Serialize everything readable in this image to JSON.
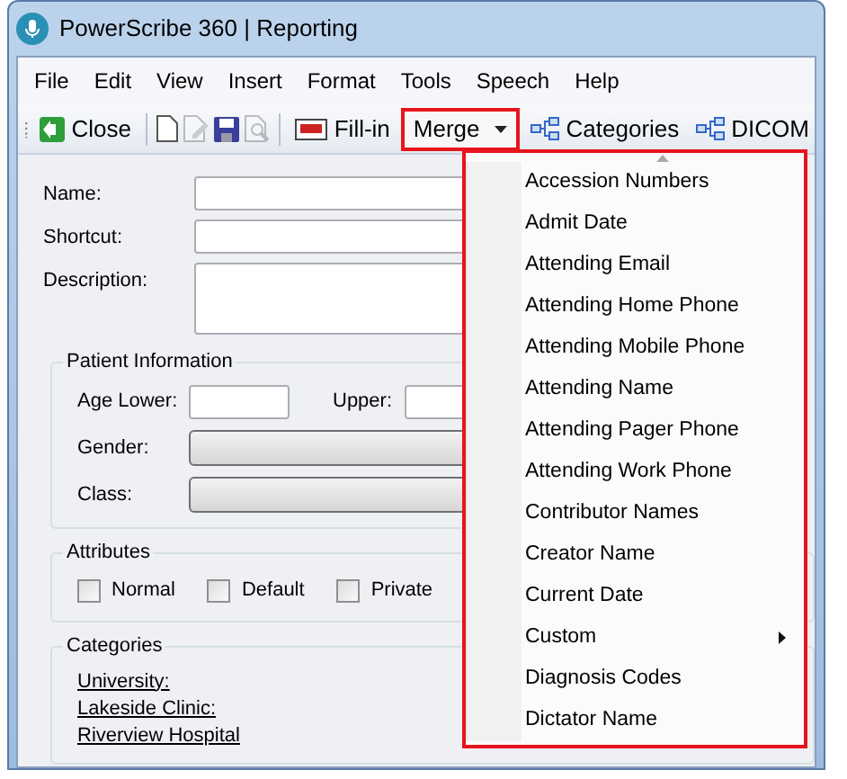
{
  "window": {
    "title": "PowerScribe 360 | Reporting"
  },
  "menu_bar": [
    {
      "label": "File"
    },
    {
      "label": "Edit"
    },
    {
      "label": "View"
    },
    {
      "label": "Insert"
    },
    {
      "label": "Format"
    },
    {
      "label": "Tools"
    },
    {
      "label": "Speech"
    },
    {
      "label": "Help"
    }
  ],
  "toolbar": [
    {
      "kind": "close",
      "label": "Close",
      "disabled": false
    },
    {
      "kind": "new",
      "disabled": false
    },
    {
      "kind": "edit",
      "disabled": true
    },
    {
      "kind": "save",
      "disabled": false
    },
    {
      "kind": "preview",
      "disabled": true
    },
    {
      "kind": "fillin",
      "label": "Fill-in",
      "disabled": false
    },
    {
      "kind": "merge",
      "label": "Merge",
      "disabled": false,
      "expanded": true
    },
    {
      "kind": "categories",
      "label": "Categories",
      "disabled": false
    },
    {
      "kind": "categories",
      "label": "DICOM",
      "disabled": false
    }
  ],
  "form": {
    "fields": [
      {
        "kind": "single",
        "label": "Name:"
      },
      {
        "kind": "single",
        "label": "Shortcut:"
      },
      {
        "kind": "multi",
        "label": "Description:"
      }
    ],
    "patient_information": {
      "title": "Patient Information",
      "age_lower": "Age Lower:",
      "upper": "Upper:",
      "gender": "Gender:",
      "class": "Class:"
    },
    "attributes": {
      "title": "Attributes",
      "options": [
        {
          "label": "Normal",
          "checked": false
        },
        {
          "label": "Default",
          "checked": false
        },
        {
          "label": "Private",
          "checked": false
        }
      ]
    },
    "categories": {
      "title": "Categories",
      "links": [
        "University:",
        "Lakeside Clinic:",
        "Riverview Hospital"
      ]
    }
  },
  "merge_menu": [
    {
      "label": "Accession Numbers",
      "has_submenu": false
    },
    {
      "label": "Admit Date",
      "has_submenu": false
    },
    {
      "label": "Attending Email",
      "has_submenu": false
    },
    {
      "label": "Attending Home Phone",
      "has_submenu": false
    },
    {
      "label": "Attending Mobile Phone",
      "has_submenu": false
    },
    {
      "label": "Attending Name",
      "has_submenu": false
    },
    {
      "label": "Attending Pager Phone",
      "has_submenu": false
    },
    {
      "label": "Attending Work Phone",
      "has_submenu": false
    },
    {
      "label": "Contributor Names",
      "has_submenu": false
    },
    {
      "label": "Creator Name",
      "has_submenu": false
    },
    {
      "label": "Current Date",
      "has_submenu": false
    },
    {
      "label": "Custom",
      "has_submenu": true
    },
    {
      "label": "Diagnosis Codes",
      "has_submenu": false
    },
    {
      "label": "Dictator Name",
      "has_submenu": false
    }
  ]
}
